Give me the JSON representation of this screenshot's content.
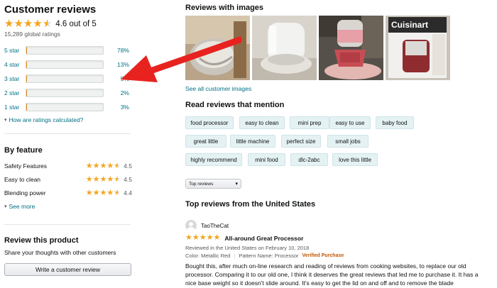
{
  "customer_reviews": {
    "title": "Customer reviews",
    "rating_stars": 4.6,
    "rating_text": "4.6 out of 5",
    "global_ratings": "15,289 global ratings",
    "histogram": [
      {
        "label": "5 star",
        "percent_text": "78%",
        "fraction": 0.78
      },
      {
        "label": "4 star",
        "percent_text": "13%",
        "fraction": 0.13
      },
      {
        "label": "3 star",
        "percent_text": "5%",
        "fraction": 0.05
      },
      {
        "label": "2 star",
        "percent_text": "2%",
        "fraction": 0.02
      },
      {
        "label": "1 star",
        "percent_text": "3%",
        "fraction": 0.03
      }
    ],
    "how_calculated": "How are ratings calculated?"
  },
  "by_feature": {
    "title": "By feature",
    "features": [
      {
        "name": "Safety Features",
        "score": "4.5",
        "stars": 4.5
      },
      {
        "name": "Easy to clean",
        "score": "4.5",
        "stars": 4.5
      },
      {
        "name": "Blending power",
        "score": "4.4",
        "stars": 4.4
      }
    ],
    "see_more": "See more"
  },
  "review_product": {
    "title": "Review this product",
    "subtitle": "Share your thoughts with other customers",
    "button": "Write a customer review"
  },
  "reviews_with_images": {
    "title": "Reviews with images",
    "images": [
      "mixing-bowl-photo",
      "processor-base-photo",
      "red-processor-photo",
      "cuisinart-box-photo"
    ],
    "box_brand_text": "Cuisinart",
    "see_all": "See all customer images"
  },
  "mentions": {
    "title": "Read reviews that mention",
    "chips": [
      "food processor",
      "easy to clean",
      "mini prep",
      "easy to use",
      "baby food",
      "great little",
      "little machine",
      "perfect size",
      "small jobs",
      "highly recommend",
      "mini food",
      "dlc-2abc",
      "love this little"
    ]
  },
  "sort_select": {
    "value": "Top reviews"
  },
  "top_reviews": {
    "title": "Top reviews from the United States",
    "review": {
      "author": "TaoTheCat",
      "stars": 5,
      "headline": "All-around Great Processor",
      "date": "Reviewed in the United States on February 10, 2018",
      "color": "Color: Metallic Red",
      "pattern": "Pattern Name: Processor",
      "verified": "Verified Purchase",
      "body": "Bought this, after much on-line research and reading of reviews from cooking websites, to replace our old processor. Comparing it to our old one, I think it deserves the great reviews that led me to purchase it. It has a nice base weight so it doesn't slide around. It's easy to get the lid on and off and to remove the blade"
    }
  },
  "colors": {
    "link": "#007185",
    "star": "#f4a41c",
    "bar_fill": "#f3a847",
    "arrow": "#e8231f",
    "chip_bg": "#e5f2f4",
    "verified": "#c45500"
  }
}
